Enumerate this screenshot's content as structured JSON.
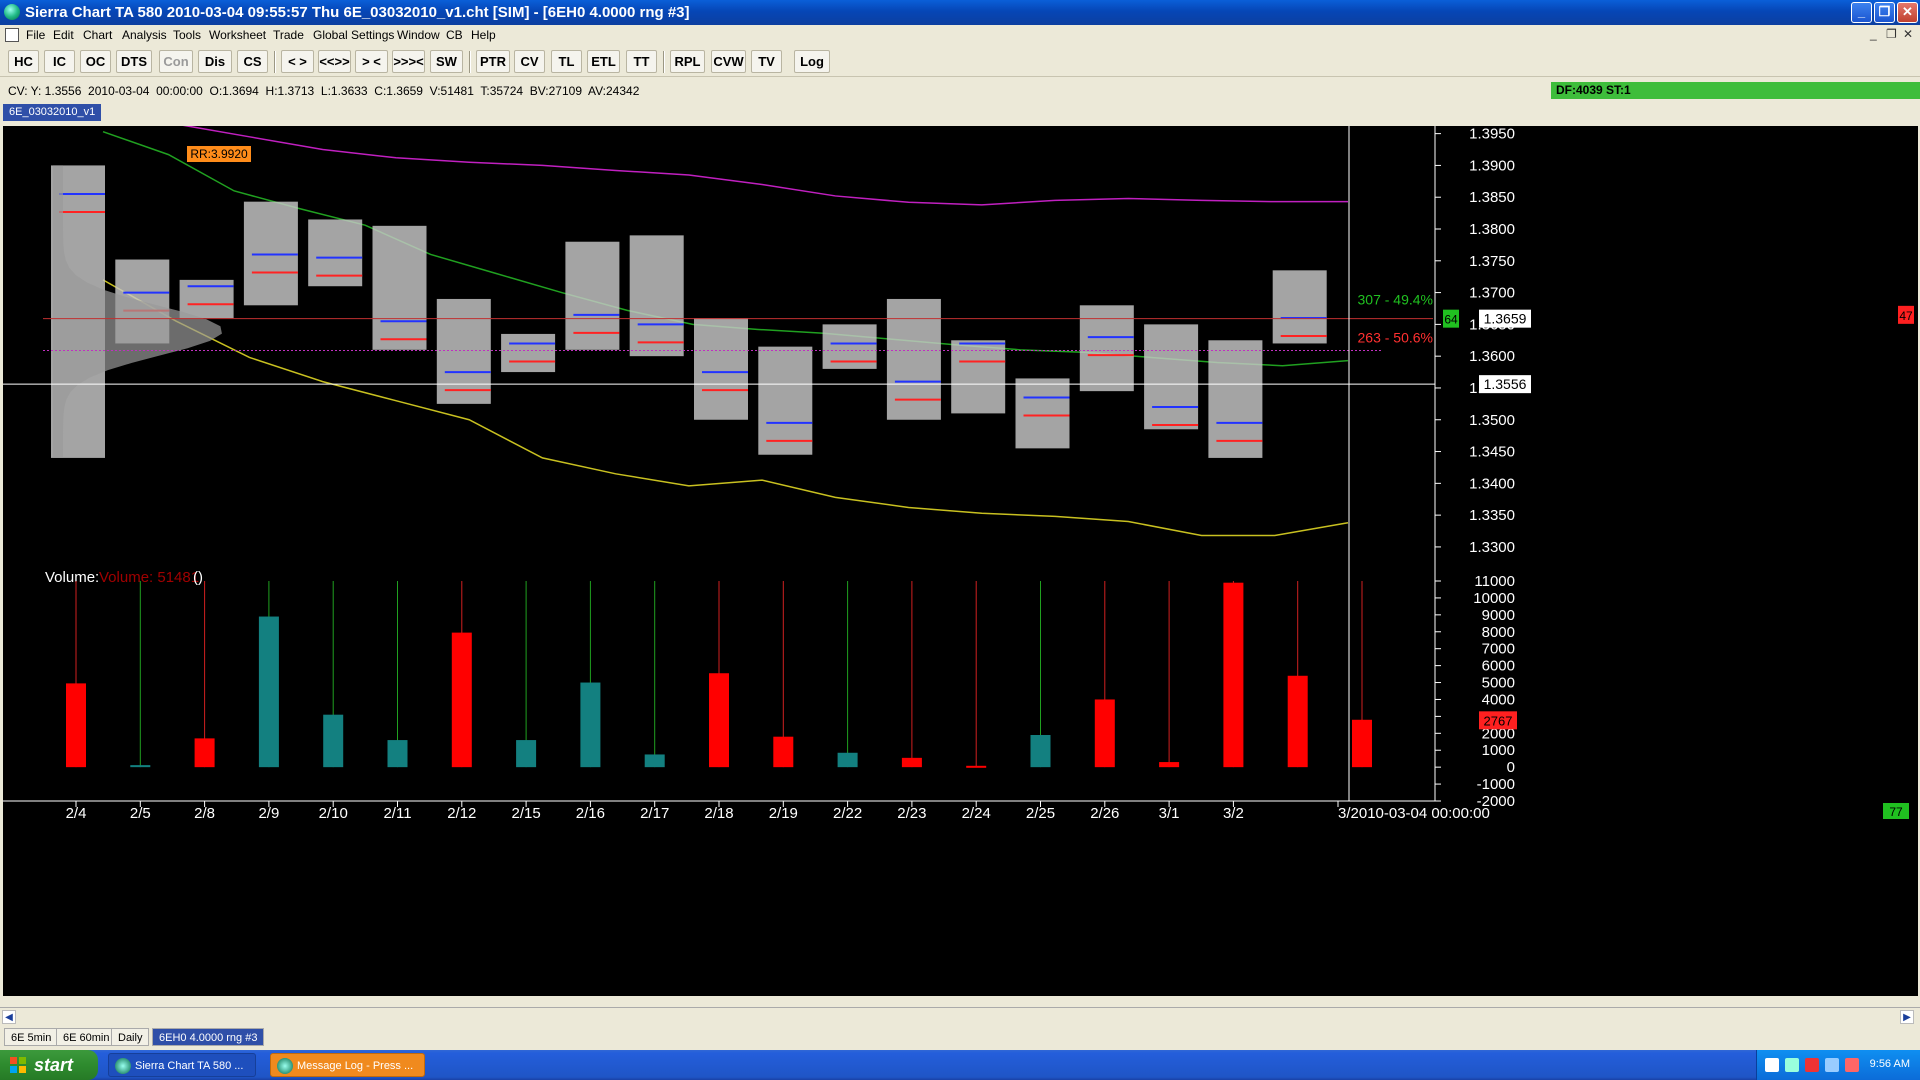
{
  "window": {
    "title": "Sierra Chart TA 580  2010-03-04  09:55:57  Thu    6E_03032010_v1.cht [SIM]  - [6EH0  4.0000 rng  #3]",
    "buttons": [
      "_",
      "❐",
      "✕"
    ]
  },
  "menu": {
    "items": [
      "File",
      "Edit",
      "Chart",
      "Analysis",
      "Tools",
      "Worksheet",
      "Trade",
      "Global Settings",
      "Window",
      "CB",
      "Help"
    ],
    "mdi_buttons": [
      "_",
      "❐",
      "✕"
    ]
  },
  "toolbar": {
    "buttons": [
      {
        "label": "HC",
        "enabled": true
      },
      {
        "label": "IC",
        "enabled": true
      },
      {
        "label": "OC",
        "enabled": true
      },
      {
        "label": "DTS",
        "enabled": true
      },
      {
        "label": "Con",
        "enabled": false
      },
      {
        "label": "Dis",
        "enabled": true
      },
      {
        "label": "CS",
        "enabled": true
      },
      {
        "label": "< >",
        "enabled": true
      },
      {
        "label": "<<>>",
        "enabled": true
      },
      {
        "label": "> <",
        "enabled": true
      },
      {
        "label": ">>><",
        "enabled": true
      },
      {
        "label": "SW",
        "enabled": true
      },
      {
        "label": "PTR",
        "enabled": true
      },
      {
        "label": "CV",
        "enabled": true
      },
      {
        "label": "TL",
        "enabled": true
      },
      {
        "label": "ETL",
        "enabled": true
      },
      {
        "label": "TT",
        "enabled": true
      },
      {
        "label": "RPL",
        "enabled": true
      },
      {
        "label": "CVW",
        "enabled": true
      },
      {
        "label": "TV",
        "enabled": true
      },
      {
        "label": "Log",
        "enabled": true
      }
    ]
  },
  "info": {
    "cursor_values": "CV: Y: 1.3556  2010-03-04  00:00:00  O:1.3694  H:1.3713  L:1.3633  C:1.3659  V:51481  T:35724  BV:27109  AV:24342",
    "status": "DF:4039  ST:1"
  },
  "chart_tab": "6E_03032010_v1",
  "colors": {
    "background": "#000000",
    "up_volume": "#138080",
    "down_volume": "#ff0000",
    "upper_band": "#c020c0",
    "middle_line": "#20a020",
    "lower_band": "#c8c020",
    "profile": "#c8c8c8"
  },
  "chart_data": {
    "type": "bar",
    "price_panel": {
      "y_ticks": [
        "1.3950",
        "1.3900",
        "1.3850",
        "1.3800",
        "1.3750",
        "1.3700",
        "1.3650",
        "1.3600",
        "1.3550",
        "1.3500",
        "1.3450",
        "1.3400",
        "1.3350",
        "1.3300"
      ],
      "ylim": [
        1.327,
        1.3962
      ],
      "current_price": "1.3659",
      "crosshair_price": "1.3556",
      "annotations": {
        "rr": "RR:3.9920",
        "upper_pct": "307 - 49.4%",
        "lower_pct": "263 - 50.6%",
        "green_marker": "64",
        "red_marker": "47"
      },
      "sessions": [
        {
          "date": "2/4",
          "high": 1.39,
          "low": 1.344,
          "poc": 1.3855
        },
        {
          "date": "2/5",
          "high": 1.3752,
          "low": 1.362,
          "poc": 1.37
        },
        {
          "date": "2/8",
          "high": 1.372,
          "low": 1.366,
          "poc": 1.371
        },
        {
          "date": "2/9",
          "high": 1.3843,
          "low": 1.368,
          "poc": 1.376
        },
        {
          "date": "2/10",
          "high": 1.3815,
          "low": 1.371,
          "poc": 1.3755
        },
        {
          "date": "2/11",
          "high": 1.3805,
          "low": 1.361,
          "poc": 1.3655
        },
        {
          "date": "2/12",
          "high": 1.369,
          "low": 1.3525,
          "poc": 1.3575
        },
        {
          "date": "2/15",
          "high": 1.3635,
          "low": 1.3575,
          "poc": 1.362
        },
        {
          "date": "2/16",
          "high": 1.378,
          "low": 1.361,
          "poc": 1.3665
        },
        {
          "date": "2/17",
          "high": 1.379,
          "low": 1.36,
          "poc": 1.365
        },
        {
          "date": "2/18",
          "high": 1.366,
          "low": 1.35,
          "poc": 1.3575
        },
        {
          "date": "2/19",
          "high": 1.3615,
          "low": 1.3445,
          "poc": 1.3495
        },
        {
          "date": "2/22",
          "high": 1.365,
          "low": 1.358,
          "poc": 1.362
        },
        {
          "date": "2/23",
          "high": 1.369,
          "low": 1.35,
          "poc": 1.356
        },
        {
          "date": "2/24",
          "high": 1.3625,
          "low": 1.351,
          "poc": 1.362
        },
        {
          "date": "2/25",
          "high": 1.3565,
          "low": 1.3455,
          "poc": 1.3535
        },
        {
          "date": "2/26",
          "high": 1.368,
          "low": 1.3545,
          "poc": 1.363
        },
        {
          "date": "3/1",
          "high": 1.365,
          "low": 1.3485,
          "poc": 1.352
        },
        {
          "date": "3/2",
          "high": 1.3625,
          "low": 1.344,
          "poc": 1.3495
        },
        {
          "date": "3/3",
          "high": 1.3735,
          "low": 1.362,
          "poc": 1.366
        }
      ],
      "upper_band": [
        1.3985,
        1.3965,
        1.3945,
        1.3925,
        1.3912,
        1.3905,
        1.39,
        1.3892,
        1.3885,
        1.387,
        1.3852,
        1.3842,
        1.3838,
        1.3845,
        1.3848,
        1.3845,
        1.3843,
        1.3843
      ],
      "middle_line": [
        1.3953,
        1.3917,
        1.386,
        1.3832,
        1.3806,
        1.376,
        1.373,
        1.37,
        1.3672,
        1.365,
        1.3642,
        1.3636,
        1.3627,
        1.3618,
        1.361,
        1.3606,
        1.3598,
        1.359,
        1.3585,
        1.3593
      ],
      "lower_band": [
        1.372,
        1.3655,
        1.3598,
        1.356,
        1.353,
        1.35,
        1.344,
        1.3415,
        1.3396,
        1.3405,
        1.3378,
        1.3362,
        1.3353,
        1.3348,
        1.334,
        1.3318,
        1.3318,
        1.3338
      ]
    },
    "volume_panel": {
      "title": "Volume:",
      "subtitle": "Volume: 51481",
      "paren": "()",
      "y_ticks": [
        "11000",
        "10000",
        "9000",
        "8000",
        "7000",
        "6000",
        "5000",
        "4000",
        "3000",
        "2000",
        "1000",
        "0",
        "-1000",
        "-2000"
      ],
      "ylim": [
        -2000,
        11000
      ],
      "current_volume": "2767",
      "categories": [
        "2/4",
        "2/5",
        "2/8",
        "2/9",
        "2/10",
        "2/11",
        "2/12",
        "2/15",
        "2/16",
        "2/17",
        "2/18",
        "2/19",
        "2/22",
        "2/23",
        "2/24",
        "2/25",
        "2/26",
        "3/1",
        "3/2",
        "3/3",
        "3/4"
      ],
      "values": [
        4950,
        120,
        1700,
        8900,
        3100,
        1600,
        7950,
        1600,
        5000,
        750,
        5550,
        1800,
        850,
        550,
        80,
        1900,
        4000,
        300,
        10900,
        5400,
        2800
      ],
      "direction": [
        "down",
        "up",
        "down",
        "up",
        "up",
        "up",
        "down",
        "up",
        "up",
        "up",
        "down",
        "down",
        "up",
        "down",
        "down",
        "up",
        "down",
        "down",
        "down",
        "down",
        "down"
      ]
    },
    "x_labels": [
      "2/4",
      "2/5",
      "2/8",
      "2/9",
      "2/10",
      "2/11",
      "2/12",
      "2/15",
      "2/16",
      "2/17",
      "2/18",
      "2/19",
      "2/22",
      "2/23",
      "2/24",
      "2/25",
      "2/26",
      "3/1",
      "3/2",
      "3/2010-03-04  00:00:00"
    ],
    "corner_value": "77"
  },
  "bottom": {
    "tabs": [
      "6E 5min",
      "6E 60min",
      "Daily",
      "6EH0  4.0000 rng  #3"
    ],
    "active_tab": 3
  },
  "taskbar": {
    "start": "start",
    "tasks": [
      "Sierra Chart TA 580  ...",
      "Message Log - Press ..."
    ],
    "clock": "9:56 AM"
  }
}
